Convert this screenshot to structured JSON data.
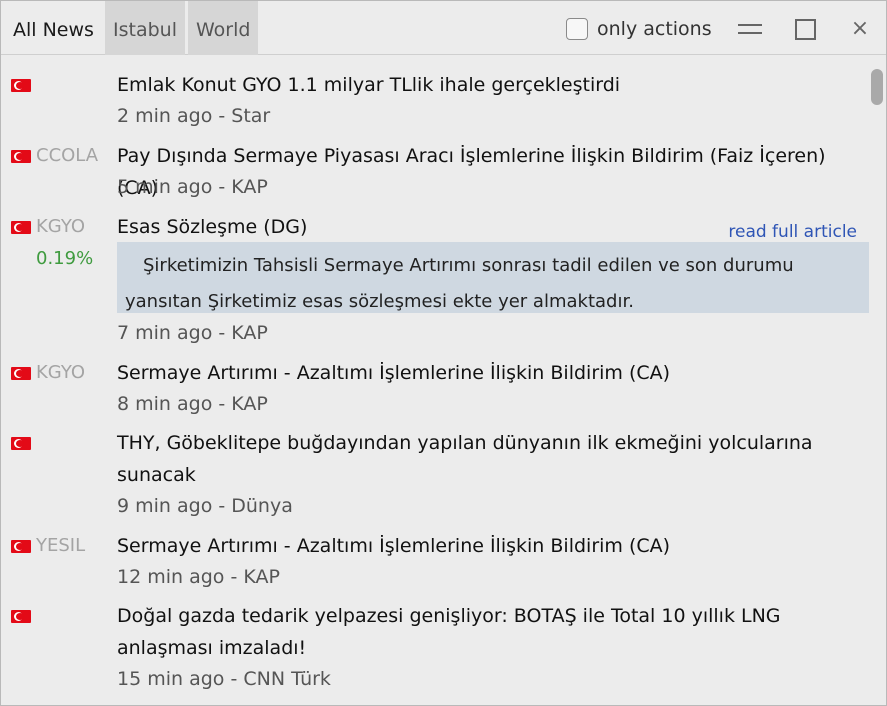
{
  "tabs": [
    {
      "label": "All News",
      "active": true
    },
    {
      "label": "Istabul",
      "active": false
    },
    {
      "label": "World",
      "active": false
    }
  ],
  "only_actions": {
    "label": "only actions",
    "checked": false
  },
  "window_controls": {
    "minimize_icon": "hamburger-minimize-icon",
    "maximize_icon": "square-maximize-icon",
    "close_icon": "×"
  },
  "news": [
    {
      "flag": "turkey-flag-icon",
      "ticker": "",
      "headline": "Emlak Konut GYO 1.1 milyar TLlik ihale gerçekleştirdi",
      "meta": "2 min ago - Star"
    },
    {
      "flag": "turkey-flag-icon",
      "ticker": "CCOLA",
      "headline": "Pay Dışında Sermaye Piyasası Aracı İşlemlerine İlişkin Bildirim (Faiz İçeren) (CA)",
      "meta": "5 min ago - KAP"
    },
    {
      "flag": "turkey-flag-icon",
      "ticker": "KGYO",
      "change": "0.19%",
      "headline": "Esas Sözleşme (DG)",
      "read_more": "read full article",
      "article": "Şirketimizin Tahsisli Sermaye Artırımı sonrası tadil edilen ve son durumu yansıtan Şirketimiz esas sözleşmesi ekte yer almaktadır.",
      "meta": "7 min ago - KAP"
    },
    {
      "flag": "turkey-flag-icon",
      "ticker": "KGYO",
      "headline": "Sermaye Artırımı - Azaltımı İşlemlerine İlişkin Bildirim (CA)",
      "meta": "8 min ago - KAP"
    },
    {
      "flag": "turkey-flag-icon",
      "ticker": "",
      "headline": "THY, Göbeklitepe buğdayından yapılan dünyanın ilk ekmeğini yolcularına sunacak",
      "meta": "9 min ago - Dünya"
    },
    {
      "flag": "turkey-flag-icon",
      "ticker": "YESIL",
      "headline": "Sermaye Artırımı - Azaltımı İşlemlerine İlişkin Bildirim (CA)",
      "meta": "12 min ago - KAP"
    },
    {
      "flag": "turkey-flag-icon",
      "ticker": "",
      "headline": "Doğal gazda tedarik yelpazesi genişliyor: BOTAŞ ile Total 10 yıllık LNG anlaşması imzaladı!",
      "meta": "15 min ago - CNN Türk"
    }
  ],
  "colors": {
    "background": "#ececec",
    "inactive_tab": "#d6d6d6",
    "ticker": "#a4a4a4",
    "positive_change": "#3f9b3f",
    "link": "#2f55b5",
    "article_bg": "#cfd8e1",
    "flag_red": "#e30a17"
  }
}
